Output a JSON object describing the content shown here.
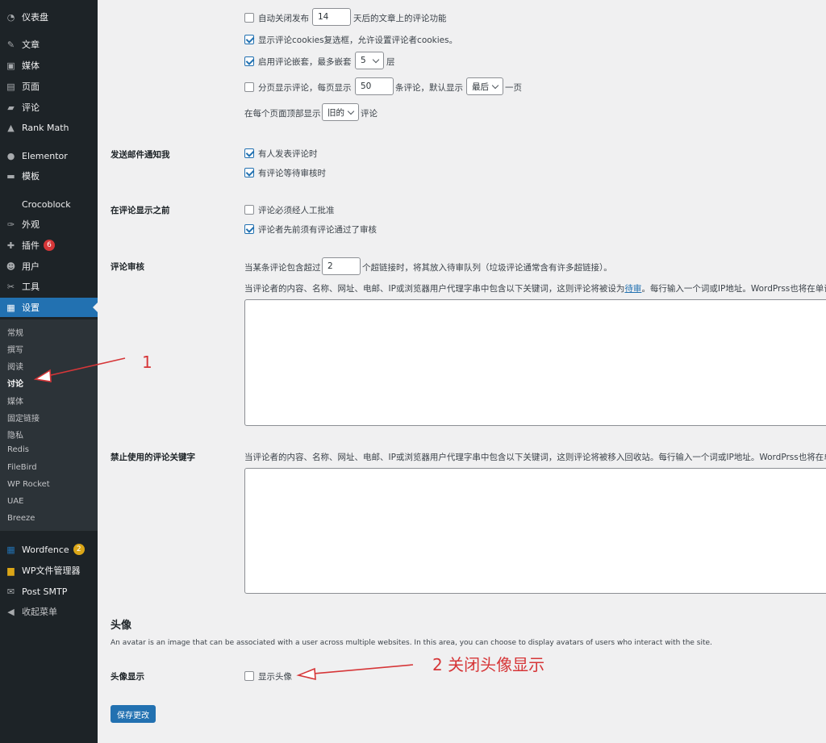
{
  "sidebar": {
    "items": [
      {
        "label": "仪表盘",
        "icon": "dashboard-icon"
      },
      {
        "label": "文章",
        "icon": "pin-icon"
      },
      {
        "label": "媒体",
        "icon": "media-icon"
      },
      {
        "label": "页面",
        "icon": "page-icon"
      },
      {
        "label": "评论",
        "icon": "comment-icon"
      },
      {
        "label": "Rank Math",
        "icon": "chart-icon"
      },
      {
        "label": "Elementor",
        "icon": "elementor-icon"
      },
      {
        "label": "模板",
        "icon": "folder-icon"
      },
      {
        "label": "Crocoblock",
        "icon": ""
      },
      {
        "label": "外观",
        "icon": "brush-icon"
      },
      {
        "label": "插件",
        "icon": "plugin-icon",
        "badge": "6"
      },
      {
        "label": "用户",
        "icon": "user-icon"
      },
      {
        "label": "工具",
        "icon": "wrench-icon"
      },
      {
        "label": "设置",
        "icon": "settings-icon",
        "active": true
      }
    ],
    "submenu": [
      "常规",
      "撰写",
      "阅读",
      "讨论",
      "媒体",
      "固定链接",
      "隐私",
      "Redis",
      "FileBird",
      "WP Rocket",
      "UAE",
      "Breeze"
    ],
    "current_sub": "讨论",
    "bottom_items": [
      {
        "label": "Wordfence",
        "icon": "wordfence-icon",
        "badge": "2"
      },
      {
        "label": "WP文件管理器",
        "icon": "file-manager-icon"
      },
      {
        "label": "Post SMTP",
        "icon": "mail-icon"
      },
      {
        "label": "收起菜单",
        "icon": "collapse-icon"
      }
    ]
  },
  "other_settings": {
    "auto_close_pre": "自动关闭发布",
    "auto_close_days": "14",
    "auto_close_post": "天后的文章上的评论功能",
    "cookies_label": "显示评论cookies复选框，允许设置评论者cookies。",
    "nested_pre": "启用评论嵌套，最多嵌套",
    "nested_levels": "5",
    "nested_post": "层",
    "paging_pre": "分页显示评论，每页显示",
    "paging_count": "50",
    "paging_mid": "条评论，默认显示",
    "paging_default": "最后",
    "paging_post": "一页",
    "order_pre": "在每个页面顶部显示",
    "order_value": "旧的",
    "order_post": "评论"
  },
  "email_me": {
    "label": "发送邮件通知我",
    "opt1": "有人发表评论时",
    "opt2": "有评论等待审核时"
  },
  "before_appears": {
    "label": "在评论显示之前",
    "opt1": "评论必须经人工批准",
    "opt2": "评论者先前须有评论通过了审核"
  },
  "moderation": {
    "label": "评论审核",
    "links_pre": "当某条评论包含超过",
    "links_count": "2",
    "links_post": "个超链接时，将其放入待审队列（垃圾评论通常含有许多超链接）。",
    "desc_pre": "当评论者的内容、名称、网址、电邮、IP或浏览器用户代理字串中包含以下关键词，这则评论将被设为",
    "desc_link": "待审",
    "desc_post": "。每行输入一个词或IP地址。WordPrss也将在单词"
  },
  "disallowed": {
    "label": "禁止使用的评论关键字",
    "desc": "当评论者的内容、名称、网址、电邮、IP或浏览器用户代理字串中包含以下关键词，这则评论将被移入回收站。每行输入一个词或IP地址。WordPrss也将在单"
  },
  "avatars": {
    "heading": "头像",
    "desc": "An avatar is an image that can be associated with a user across multiple websites. In this area, you can choose to display avatars of users who interact with the site.",
    "display_label": "头像显示",
    "show_label": "显示头像"
  },
  "save_button": "保存更改",
  "annotations": {
    "one": "1",
    "two": "2 关闭头像显示",
    "color": "#d63638"
  }
}
